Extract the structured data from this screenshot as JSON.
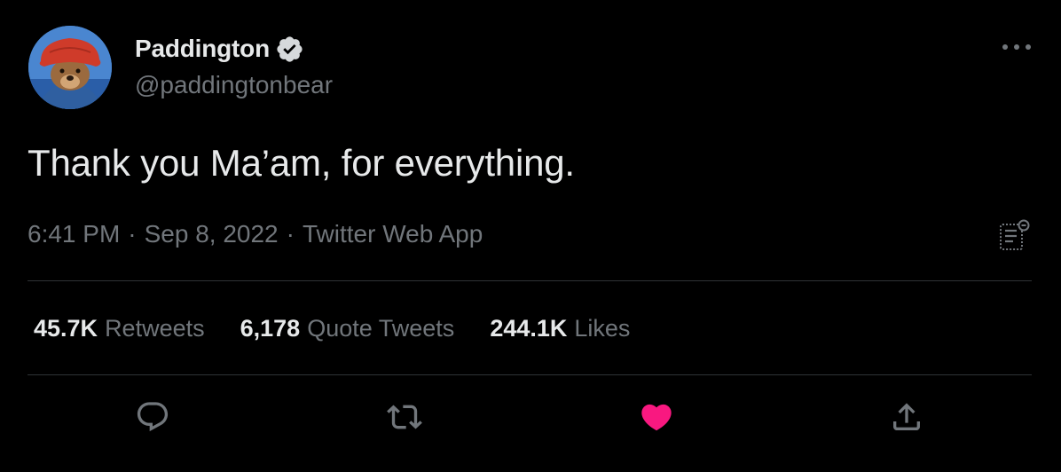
{
  "user": {
    "display_name": "Paddington",
    "handle": "@paddingtonbear",
    "verified": true
  },
  "tweet": {
    "text": "Thank you Ma’am, for everything.",
    "time": "6:41 PM",
    "date": "Sep 8, 2022",
    "source": "Twitter Web App",
    "separator": "·"
  },
  "stats": {
    "retweets": {
      "count": "45.7K",
      "label": "Retweets"
    },
    "quotes": {
      "count": "6,178",
      "label": "Quote Tweets"
    },
    "likes": {
      "count": "244.1K",
      "label": "Likes"
    }
  },
  "actions": [
    "reply-icon",
    "retweet-icon",
    "heart-icon",
    "share-icon"
  ],
  "colors": {
    "background": "#000000",
    "primary_text": "#e7e9ea",
    "secondary_text": "#71767b",
    "divider": "#2f3336",
    "like_active": "#f91880"
  }
}
